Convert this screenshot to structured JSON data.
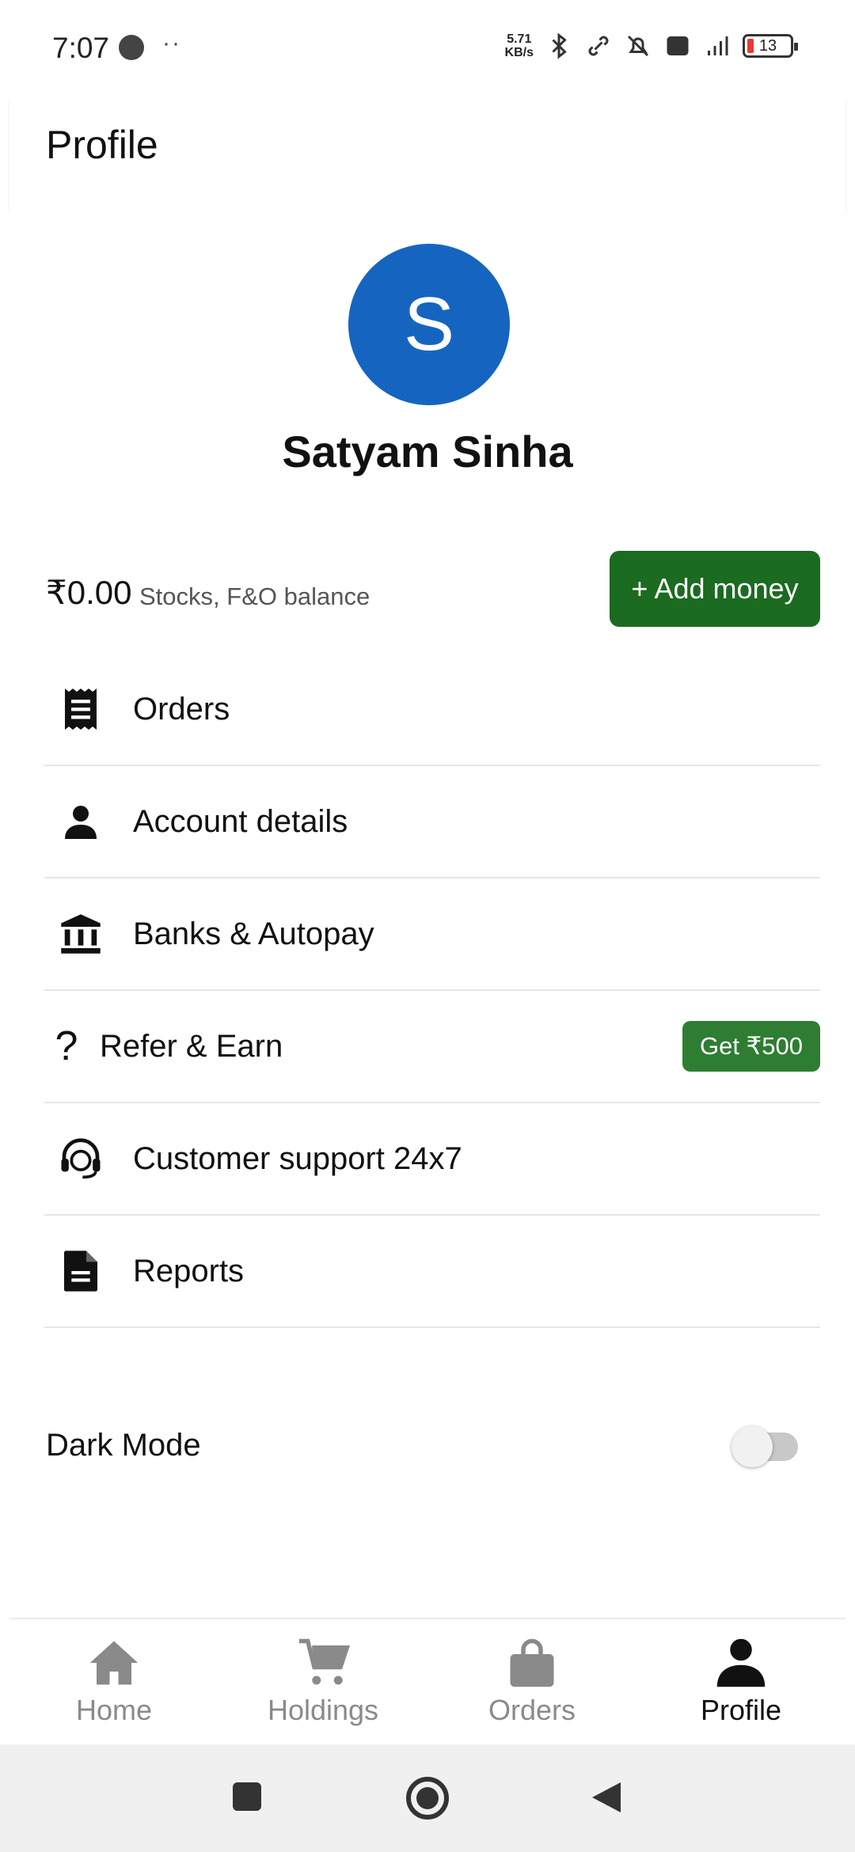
{
  "status_bar": {
    "time": "7:07",
    "dots": "··",
    "net_speed_value": "5.71",
    "net_speed_unit": "KB/s",
    "battery": "13"
  },
  "header": {
    "title": "Profile"
  },
  "profile": {
    "avatar_letter": "S",
    "avatar_color": "#1565c0",
    "name": "Satyam Sinha"
  },
  "balance": {
    "amount": "₹0.00",
    "label": "Stocks, F&O balance",
    "add_money_label": "+ Add money",
    "button_color": "#1b6b21"
  },
  "menu": {
    "items": [
      {
        "label": "Orders",
        "icon": "receipt-icon"
      },
      {
        "label": "Account details",
        "icon": "person-icon"
      },
      {
        "label": "Banks & Autopay",
        "icon": "bank-icon"
      },
      {
        "label": "Refer & Earn",
        "icon": "question-icon",
        "badge": "Get ₹500"
      },
      {
        "label": "Customer support 24x7",
        "icon": "headset-icon"
      },
      {
        "label": "Reports",
        "icon": "document-icon"
      }
    ]
  },
  "dark_mode": {
    "label": "Dark Mode",
    "enabled": false
  },
  "bottom_nav": {
    "items": [
      {
        "label": "Home",
        "icon": "home-icon",
        "active": false
      },
      {
        "label": "Holdings",
        "icon": "cart-icon",
        "active": false
      },
      {
        "label": "Orders",
        "icon": "bag-icon",
        "active": false
      },
      {
        "label": "Profile",
        "icon": "person-icon",
        "active": true
      }
    ]
  }
}
